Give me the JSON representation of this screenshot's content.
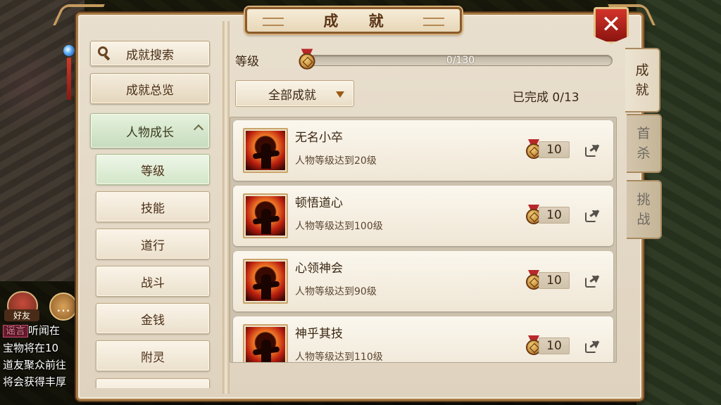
{
  "window": {
    "title": "成 就",
    "close_label": "✕"
  },
  "left_nav": {
    "search_label": "成就搜索",
    "overview_label": "成就总览",
    "category_label": "人物成长",
    "sub_items": [
      {
        "label": "等级",
        "active": true
      },
      {
        "label": "技能",
        "active": false
      },
      {
        "label": "道行",
        "active": false
      },
      {
        "label": "战斗",
        "active": false
      },
      {
        "label": "金钱",
        "active": false
      },
      {
        "label": "附灵",
        "active": false
      }
    ]
  },
  "level": {
    "label": "等级",
    "progress_text": "0/130",
    "current": 0,
    "max": 130
  },
  "filter": {
    "selected": "全部成就"
  },
  "completed_text": "已完成 0/13",
  "achievements": [
    {
      "title": "无名小卒",
      "desc": "人物等级达到20级",
      "points": "10"
    },
    {
      "title": "顿悟道心",
      "desc": "人物等级达到100级",
      "points": "10"
    },
    {
      "title": "心领神会",
      "desc": "人物等级达到90级",
      "points": "10"
    },
    {
      "title": "神乎其技",
      "desc": "人物等级达到110级",
      "points": "10"
    }
  ],
  "right_tabs": [
    {
      "chars": [
        "成",
        "就"
      ],
      "active": true
    },
    {
      "chars": [
        "首",
        "杀"
      ],
      "active": false
    },
    {
      "chars": [
        "挑",
        "战"
      ],
      "active": false
    }
  ],
  "background_chat": {
    "friend_label": "好友",
    "tag": "谣言",
    "lines": [
      "听闻在",
      "宝物将在10",
      "道友聚众前往",
      "将会获得丰厚"
    ]
  },
  "colors": {
    "accent_brown": "#5a3416",
    "frame": "#a97a45",
    "close_red": "#c1271f",
    "active_green": "#d2e6c8"
  }
}
